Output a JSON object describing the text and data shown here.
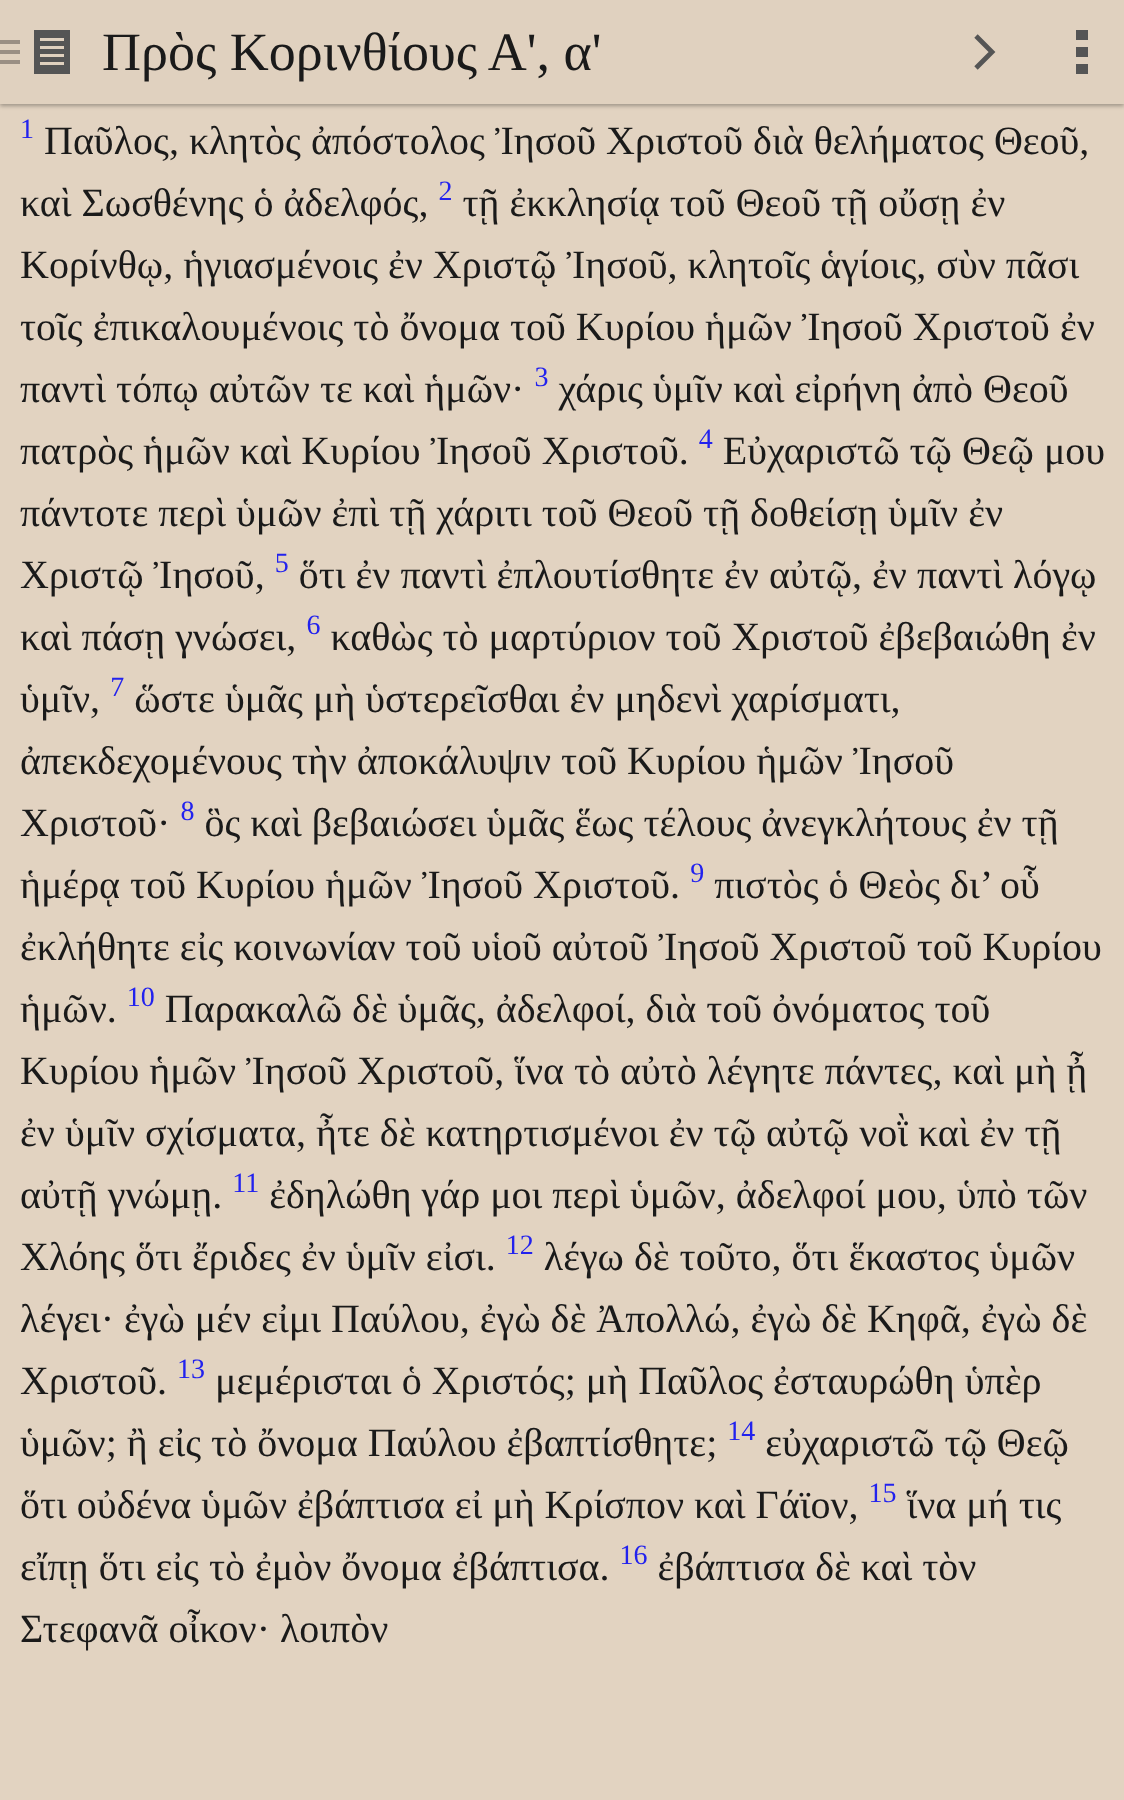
{
  "toolbar": {
    "title": "Πρὸς Κορινθίους Α', α'"
  },
  "verses": [
    {
      "number": "1",
      "text": "Παῦλος, κλητὸς ἀπόστολος Ἰησοῦ Χριστοῦ διὰ θελήματος Θεοῦ, καὶ Σωσθένης ὁ ἀδελφός,"
    },
    {
      "number": "2",
      "text": "τῇ ἐκκλησίᾳ τοῦ Θεοῦ τῇ οὔσῃ ἐν Κορίνθῳ, ἡγιασμένοις ἐν Χριστῷ Ἰησοῦ, κλητοῖς ἁγίοις, σὺν πᾶσι τοῖς ἐπικαλουμένοις τὸ ὄνομα τοῦ Κυρίου ἡμῶν Ἰησοῦ Χριστοῦ ἐν παντὶ τόπῳ αὐτῶν τε καὶ ἡμῶν·"
    },
    {
      "number": "3",
      "text": "χάρις ὑμῖν καὶ εἰρήνη ἀπὸ Θεοῦ πατρὸς ἡμῶν καὶ Κυρίου Ἰησοῦ Χριστοῦ."
    },
    {
      "number": "4",
      "text": "Εὐχαριστῶ τῷ Θεῷ μου πάντοτε περὶ ὑμῶν ἐπὶ τῇ χάριτι τοῦ Θεοῦ τῇ δοθείσῃ ὑμῖν ἐν Χριστῷ Ἰησοῦ,"
    },
    {
      "number": "5",
      "text": "ὅτι ἐν παντὶ ἐπλουτίσθητε ἐν αὐτῷ, ἐν παντὶ λόγῳ καὶ πάσῃ γνώσει,"
    },
    {
      "number": "6",
      "text": "καθὼς τὸ μαρτύριον τοῦ Χριστοῦ ἐβεβαιώθη ἐν ὑμῖν,"
    },
    {
      "number": "7",
      "text": "ὥστε ὑμᾶς μὴ ὑστερεῖσθαι ἐν μηδενὶ χαρίσματι, ἀπεκδεχομένους τὴν ἀποκάλυψιν τοῦ Κυρίου ἡμῶν Ἰησοῦ Χριστοῦ·"
    },
    {
      "number": "8",
      "text": "ὃς καὶ βεβαιώσει ὑμᾶς ἕως τέλους ἀνεγκλήτους ἐν τῇ ἡμέρᾳ τοῦ Κυρίου ἡμῶν Ἰησοῦ Χριστοῦ."
    },
    {
      "number": "9",
      "text": "πιστὸς ὁ Θεὸς δι’ οὗ ἐκλήθητε εἰς κοινωνίαν τοῦ υἱοῦ αὐτοῦ Ἰησοῦ Χριστοῦ τοῦ Κυρίου ἡμῶν."
    },
    {
      "number": "10",
      "text": "Παρακαλῶ δὲ ὑμᾶς, ἀδελφοί, διὰ τοῦ ὀνόματος τοῦ Κυρίου ἡμῶν Ἰησοῦ Χριστοῦ, ἵνα τὸ αὐτὸ λέγητε πάντες, καὶ μὴ ᾖ ἐν ὑμῖν σχίσματα, ἦτε δὲ κατηρτισμένοι ἐν τῷ αὐτῷ νοῒ καὶ ἐν τῇ αὐτῇ γνώμῃ."
    },
    {
      "number": "11",
      "text": "ἐδηλώθη γάρ μοι περὶ ὑμῶν, ἀδελφοί μου, ὑπὸ τῶν Χλόης ὅτι ἔριδες ἐν ὑμῖν εἰσι."
    },
    {
      "number": "12",
      "text": "λέγω δὲ τοῦτο, ὅτι ἕκαστος ὑμῶν λέγει· ἐγὼ μέν εἰμι Παύλου, ἐγὼ δὲ Ἀπολλώ, ἐγὼ δὲ Κηφᾶ, ἐγὼ δὲ Χριστοῦ."
    },
    {
      "number": "13",
      "text": "μεμέρισται ὁ Χριστός; μὴ Παῦλος ἐσταυρώθη ὑπὲρ ὑμῶν; ἢ εἰς τὸ ὄνομα Παύλου ἐβαπτίσθητε;"
    },
    {
      "number": "14",
      "text": "εὐχαριστῶ τῷ Θεῷ ὅτι οὐδένα ὑμῶν ἐβάπτισα εἰ μὴ Κρίσπον καὶ Γάϊον,"
    },
    {
      "number": "15",
      "text": "ἵνα μή τις εἴπῃ ὅτι εἰς τὸ ἐμὸν ὄνομα ἐβάπτισα."
    },
    {
      "number": "16",
      "text": "ἐβάπτισα δὲ καὶ τὸν Στεφανᾶ οἶκον· λοιπὸν"
    }
  ]
}
